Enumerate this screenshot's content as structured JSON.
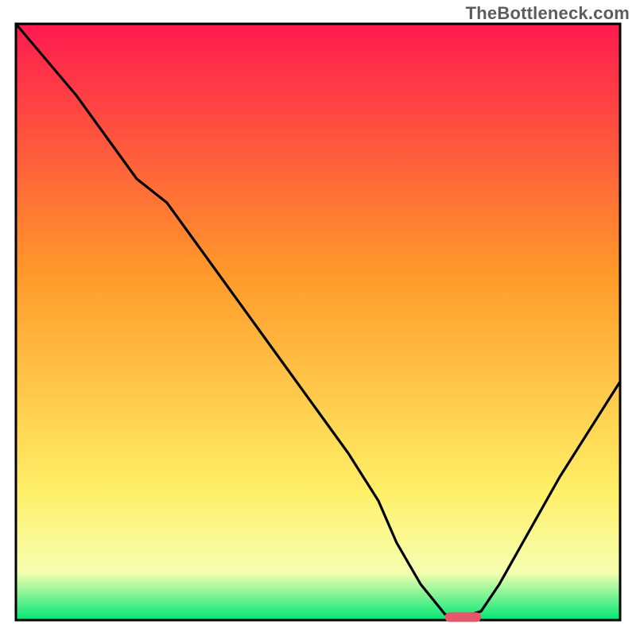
{
  "watermark": "TheBottleneck.com",
  "chart_data": {
    "type": "line",
    "title": "",
    "xlabel": "",
    "ylabel": "",
    "xlim": [
      0,
      100
    ],
    "ylim": [
      0,
      100
    ],
    "background_gradient": {
      "top": "#ff1a4f",
      "mid_upper": "#ff9a2a",
      "mid_lower": "#ffef66",
      "bottom": "#00e676"
    },
    "curve": {
      "name": "bottleneck-curve",
      "x": [
        0,
        5,
        10,
        15,
        20,
        25,
        30,
        35,
        40,
        45,
        50,
        55,
        60,
        63,
        67,
        71,
        73,
        74,
        77,
        80,
        85,
        90,
        95,
        100
      ],
      "y": [
        100,
        94,
        88,
        81,
        74,
        70,
        63,
        56,
        49,
        42,
        35,
        28,
        20,
        13,
        6,
        1,
        0.5,
        0.5,
        1.5,
        6,
        15,
        24,
        32,
        40
      ]
    },
    "marker": {
      "name": "optimum-marker",
      "x_start": 71,
      "x_end": 77,
      "y": 0.5,
      "color": "#e5576a"
    }
  }
}
